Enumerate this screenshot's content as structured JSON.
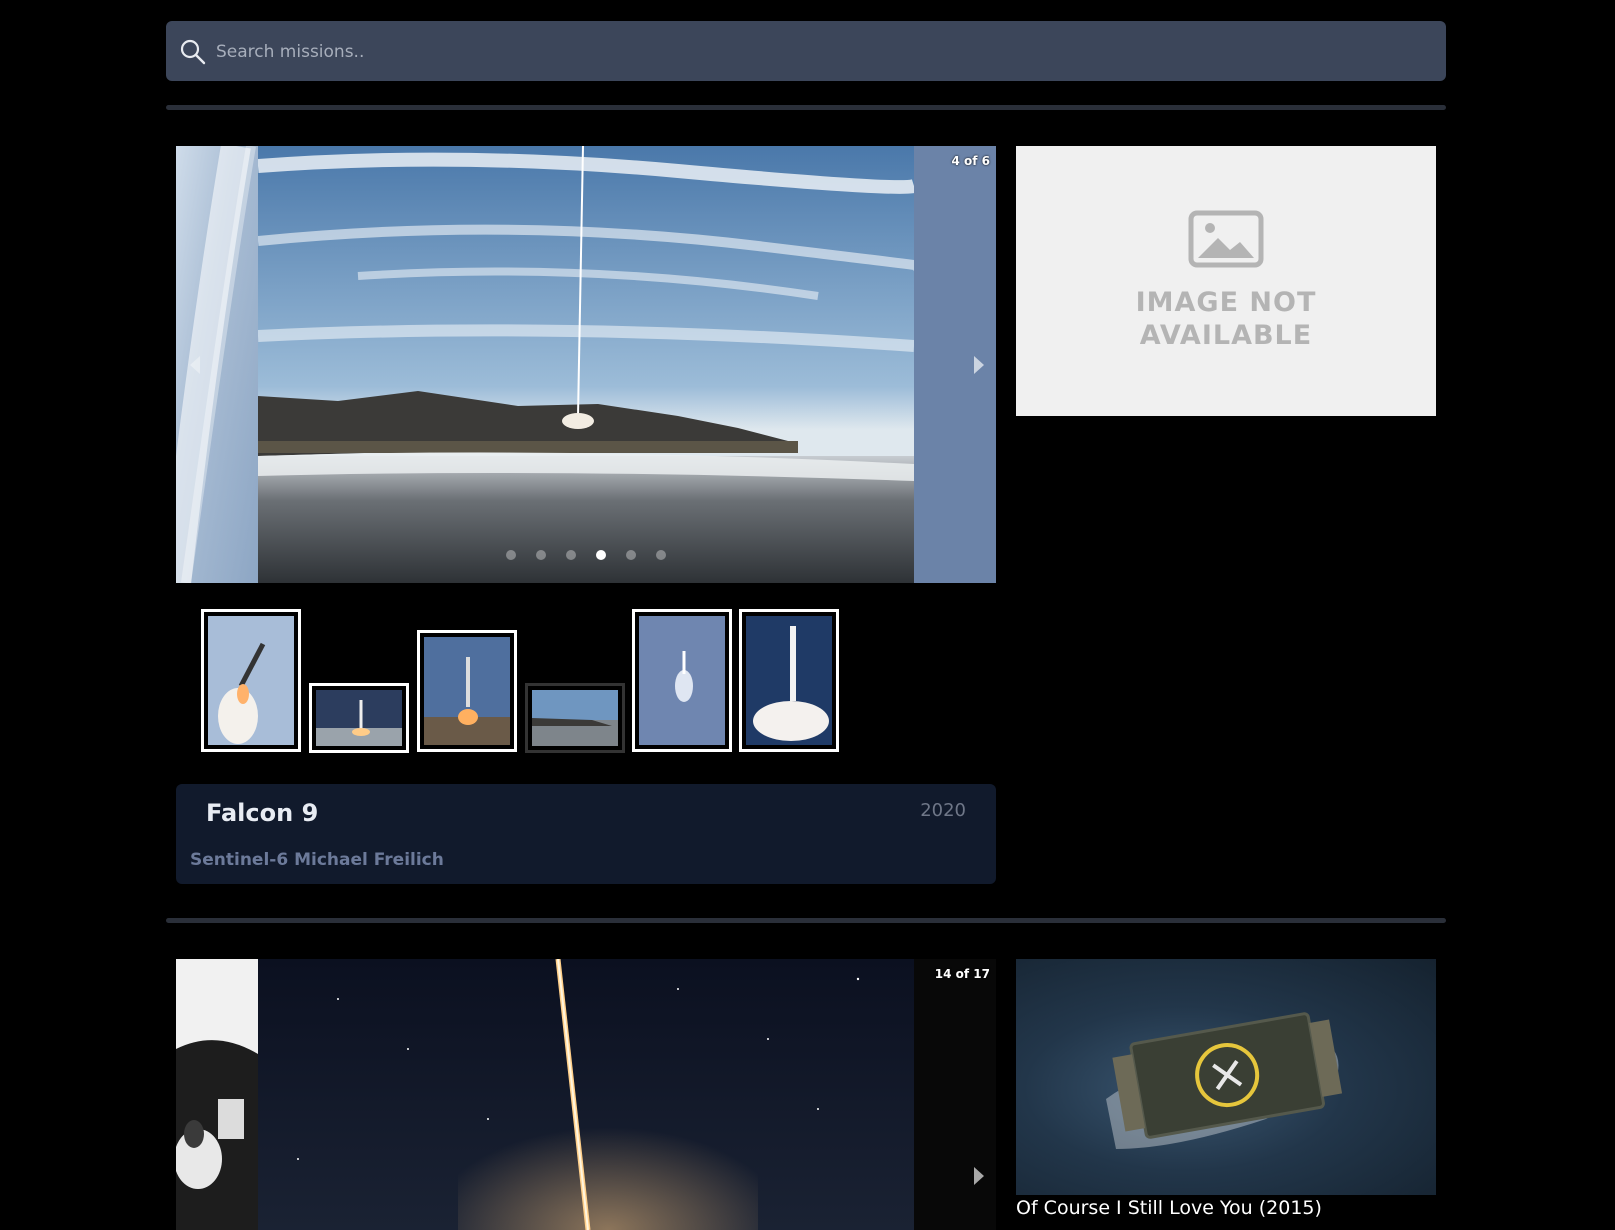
{
  "search": {
    "placeholder": "Search missions.."
  },
  "launches": [
    {
      "carousel": {
        "counter": "4 of 6",
        "slides": 6,
        "active_index": 4
      },
      "thumbnail_selected": [
        true,
        true,
        true,
        false,
        true,
        true
      ],
      "rocket": "Falcon 9",
      "year": "2020",
      "mission": "Sentinel-6 Michael Freilich",
      "patch_placeholder_text_line1": "IMAGE NOT",
      "patch_placeholder_text_line2": "AVAILABLE"
    },
    {
      "carousel": {
        "counter": "14 of 17",
        "slides": 17,
        "active_index": 14
      },
      "patch_caption": "Of Course I Still Love You (2015)"
    }
  ],
  "colors": {
    "background": "#000000",
    "search_bg": "#3c465a",
    "info_bg": "#111a2c",
    "mission_text": "#6c7a9a",
    "year_text": "#6f7788"
  },
  "icons": [
    "search-icon",
    "image-placeholder-icon",
    "chevron-left-icon",
    "chevron-right-icon"
  ]
}
